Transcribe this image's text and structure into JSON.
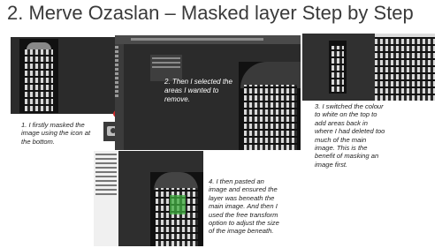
{
  "page": {
    "title": "2. Merve Ozaslan – Masked layer Step by Step"
  },
  "captions": {
    "step1": [
      "1. I firstly masked the",
      "image using the icon at",
      "the bottom."
    ],
    "step2": [
      "2. Then I selected the",
      "areas I wanted to",
      "remove."
    ],
    "step3": [
      "3. I switched the colour",
      "to white on the top to",
      "add areas back in",
      "where I had deleted too",
      "much of the main",
      "image. This is the",
      "benefit of masking an",
      "image first."
    ],
    "step4": [
      "4. I then pasted an",
      "image and ensured the",
      "layer was beneath the",
      "main image. And then I",
      "used the free transform",
      "option to adjust the size",
      "of the image beneath."
    ]
  },
  "colors": {
    "highlight_circle": "#d42a2a",
    "mask_area": "#3fae3f",
    "ps_dark": "#2b2b2b"
  },
  "icons": {
    "mask": "layer-mask-icon"
  }
}
